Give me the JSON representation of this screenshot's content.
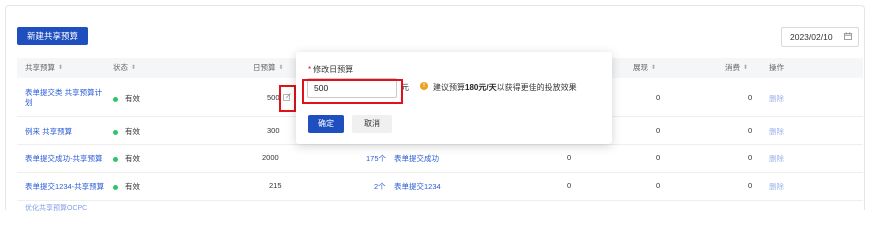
{
  "toolbar": {
    "new_button": "新建共享预算",
    "date": "2023/02/10"
  },
  "table": {
    "headers": {
      "name": "共享预算",
      "status": "状态",
      "daily_budget": "日预算",
      "spend": "消费",
      "actions": "操作",
      "partial": "展现"
    },
    "rows": [
      {
        "name": "表单提交类 共享预算计划",
        "status": "有效",
        "budget": "500",
        "count": "",
        "plan": "",
        "col5": "",
        "col6": "0",
        "col7": "0",
        "action": "删除"
      },
      {
        "name": "例来 共享预算",
        "status": "有效",
        "budget": "300",
        "count": "",
        "plan": "",
        "col5": "",
        "col6": "0",
        "col7": "0",
        "action": "删除"
      },
      {
        "name": "表单提交成功-共享预算",
        "status": "有效",
        "budget": "2000",
        "count": "175个",
        "plan": "表单提交成功",
        "col5": "0",
        "col6": "0",
        "col7": "0",
        "action": "删除"
      },
      {
        "name": "表单提交1234-共享预算",
        "status": "有效",
        "budget": "215",
        "count": "2个",
        "plan": "表单提交1234",
        "col5": "0",
        "col6": "0",
        "col7": "0",
        "action": "删除"
      }
    ],
    "partial_row": "优化共享预算OCPC"
  },
  "popover": {
    "label": "修改日预算",
    "input_value": "500",
    "unit": "元",
    "tip_prefix": "建议预算",
    "tip_amount": "180元/天",
    "tip_suffix": "以获得更佳的投放效果",
    "ok": "确定",
    "cancel": "取消"
  }
}
